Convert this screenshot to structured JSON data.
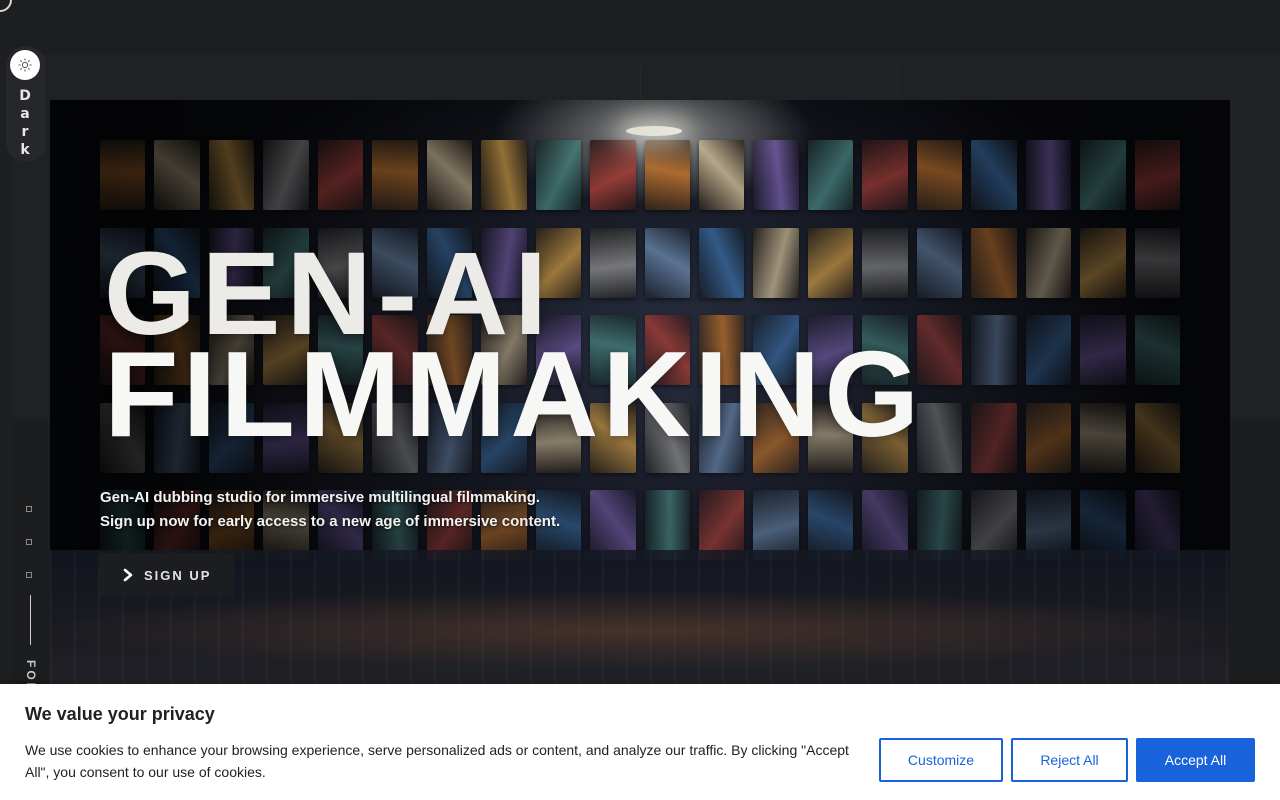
{
  "theme_toggle": {
    "label": "Dark",
    "icon": "sun-icon"
  },
  "hero": {
    "title_line1": "GEN-AI",
    "title_line2": "FILMMAKING",
    "subtitle_line1": "Gen-AI dubbing studio for immersive multilingual filmmaking.",
    "subtitle_line2": "Sign up now for early access to a new age of immersive content.",
    "cta_label": "SIGN UP",
    "cta_icon": "chevron-right-icon"
  },
  "side_nav": {
    "follow_label": "FOL"
  },
  "cookie_banner": {
    "title": "We value your privacy",
    "text": "We use cookies to enhance your browsing experience, serve personalized ads or content, and analyze our traffic. By clicking \"Accept All\", you consent to our use of cookies.",
    "customize_label": "Customize",
    "reject_label": "Reject All",
    "accept_label": "Accept All"
  },
  "colors": {
    "page_bg": "#1e1f21",
    "accent_blue": "#1863dc",
    "hero_text": "#ecebe7",
    "button_dark": "#1c1d21"
  }
}
